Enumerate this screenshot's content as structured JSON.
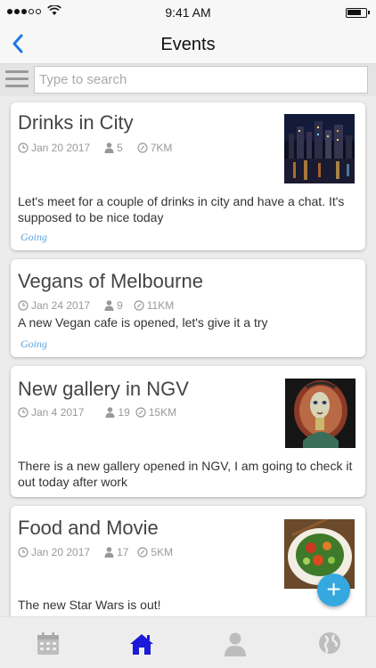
{
  "status_bar": {
    "time": "9:41 AM"
  },
  "nav": {
    "title": "Events",
    "back_icon": "chevron-left-icon"
  },
  "search": {
    "placeholder": "Type to search",
    "value": ""
  },
  "events": [
    {
      "title": "Drinks in City",
      "date": "Jan 20 2017",
      "attendees": "5",
      "distance": "7KM",
      "description": "Let's meet for a couple of drinks in city and have a chat. It's supposed to be nice today",
      "status": "Going",
      "image": "city-night-photo"
    },
    {
      "title": "Vegans of Melbourne",
      "date": "Jan 24 2017",
      "attendees": "9",
      "distance": "11KM",
      "description": "A new Vegan cafe is opened, let's give it a try",
      "status": "Going",
      "image": ""
    },
    {
      "title": "New gallery in NGV",
      "date": "Jan 4 2017",
      "attendees": "19",
      "distance": "15KM",
      "description": "There is a new gallery opened in NGV, I am going to check it out today after work",
      "status": "",
      "image": "portrait-painting"
    },
    {
      "title": "Food and Movie",
      "date": "Jan 20 2017",
      "attendees": "17",
      "distance": "5KM",
      "description": "The new Star Wars is out!",
      "status": "",
      "image": "food-dish-photo"
    }
  ],
  "fab": {
    "label": "+"
  },
  "tabs": [
    {
      "name": "calendar-icon",
      "active": false
    },
    {
      "name": "home-icon",
      "active": true
    },
    {
      "name": "profile-icon",
      "active": false
    },
    {
      "name": "globe-icon",
      "active": false
    }
  ],
  "colors": {
    "accent": "#35a8e0",
    "active_tab": "#1a1ad8",
    "status": "#5aa6e3",
    "back": "#1a7ae8"
  }
}
